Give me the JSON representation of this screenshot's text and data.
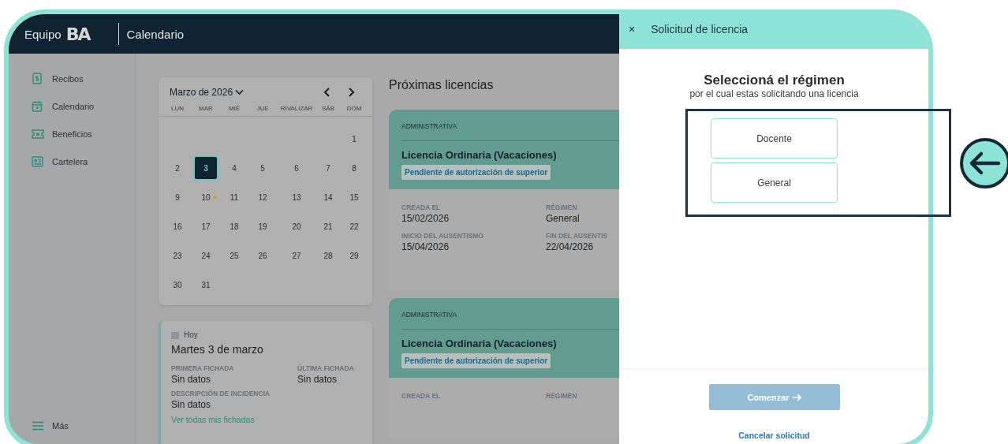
{
  "app": {
    "brand": "Equipo",
    "logo_text": "BA",
    "section_title": "Calendario"
  },
  "sidebar": {
    "items": [
      {
        "label": "Recibos"
      },
      {
        "label": "Calendario"
      },
      {
        "label": "Beneficios"
      },
      {
        "label": "Cartelera"
      }
    ],
    "more": "Más"
  },
  "calendar": {
    "month": "Marzo de 2026",
    "weekdays": [
      "LUN",
      "MAR",
      "MIÉ",
      "JUE",
      "RIVALIZAR",
      "SÁB",
      "DOM"
    ],
    "weeks": [
      [
        {
          "label": "1",
          "selected": false,
          "event": false
        }
      ],
      [
        {
          "label": "2",
          "selected": false,
          "event": false
        },
        {
          "label": "3",
          "selected": true,
          "event": false
        },
        {
          "label": "4",
          "selected": false,
          "event": false
        },
        {
          "label": "5",
          "selected": false,
          "event": false
        },
        {
          "label": "6",
          "selected": false,
          "event": false
        },
        {
          "label": "7",
          "selected": false,
          "event": false
        },
        {
          "label": "8",
          "selected": false,
          "event": false
        }
      ],
      [
        {
          "label": "9",
          "selected": false,
          "event": false
        },
        {
          "label": "10",
          "selected": false,
          "event": true
        },
        {
          "label": "11",
          "selected": false,
          "event": false
        },
        {
          "label": "12",
          "selected": false,
          "event": false
        },
        {
          "label": "13",
          "selected": false,
          "event": false
        },
        {
          "label": "14",
          "selected": false,
          "event": false
        },
        {
          "label": "15",
          "selected": false,
          "event": false
        }
      ],
      [
        {
          "label": "16",
          "selected": false,
          "event": false
        },
        {
          "label": "17",
          "selected": false,
          "event": false
        },
        {
          "label": "18",
          "selected": false,
          "event": false
        },
        {
          "label": "19",
          "selected": false,
          "event": false
        },
        {
          "label": "20",
          "selected": false,
          "event": false
        },
        {
          "label": "21",
          "selected": false,
          "event": false
        },
        {
          "label": "22",
          "selected": false,
          "event": false
        }
      ],
      [
        {
          "label": "23",
          "selected": false,
          "event": false
        },
        {
          "label": "24",
          "selected": false,
          "event": false
        },
        {
          "label": "25",
          "selected": false,
          "event": false
        },
        {
          "label": "26",
          "selected": false,
          "event": false
        },
        {
          "label": "27",
          "selected": false,
          "event": false
        },
        {
          "label": "28",
          "selected": false,
          "event": false
        },
        {
          "label": "29",
          "selected": false,
          "event": false
        }
      ],
      [
        {
          "label": "30",
          "selected": false,
          "event": false
        },
        {
          "label": "31",
          "selected": false,
          "event": false
        }
      ]
    ]
  },
  "today": {
    "tag": "Hoy",
    "date": "Martes 3 de marzo",
    "fields": [
      {
        "label": "PRIMERA FICHADA",
        "value": "Sin datos"
      },
      {
        "label": "ÚLTIMA FICHADA",
        "value": "Sin datos"
      },
      {
        "label": "DESCRIPCIÓN DE INCIDENCIA",
        "value": "Sin datos"
      }
    ],
    "link": "Ver todas mis fichadas"
  },
  "upcoming": {
    "title": "Próximas licencias",
    "cards": [
      {
        "category": "ADMINISTRATIVA",
        "name": "Licencia Ordinaria (Vacaciones)",
        "status": "Pendiente de autorización de superior",
        "fields": [
          {
            "label": "CREADA EL",
            "value": "15/02/2026"
          },
          {
            "label": "RÉGIMEN",
            "value": "General"
          },
          {
            "label": "INICIO DEL AUSENTISMO",
            "value": "15/04/2026"
          },
          {
            "label": "FIN DEL AUSENTIS",
            "value": "22/04/2026"
          }
        ]
      },
      {
        "category": "ADMINISTRATIVA",
        "name": "Licencia Ordinaria (Vacaciones)",
        "status": "Pendiente de autorización de superior",
        "fields": [
          {
            "label": "CREADA EL"
          },
          {
            "label": "RÉGIMEN"
          }
        ]
      }
    ]
  },
  "drawer": {
    "close": "×",
    "title": "Solicitud de licencia",
    "heading": "Seleccioná el régimen",
    "subheading": "por el cual estas solicitando una licencia",
    "options": [
      {
        "label": "Docente",
        "selected": false
      },
      {
        "label": "General",
        "selected": false
      }
    ],
    "primary_button": {
      "label": "Comenzar",
      "disabled": true
    },
    "cancel_link": "Cancelar solicitud"
  }
}
